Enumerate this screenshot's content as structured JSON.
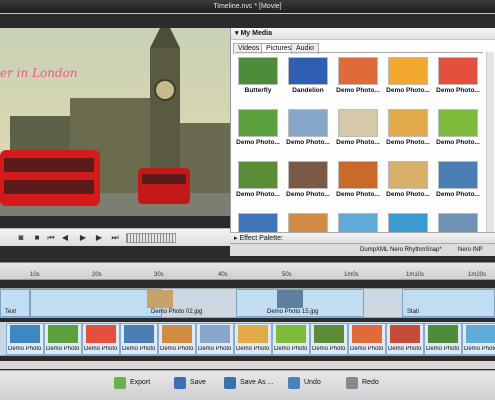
{
  "window": {
    "title": "Timeline.nvc * [Movie]"
  },
  "preview": {
    "overlay_text": "er in London"
  },
  "player": {
    "buttons": [
      "camera-icon",
      "stop-icon",
      "prev-icon",
      "rewind-icon",
      "play-icon",
      "forward-icon",
      "next-icon"
    ]
  },
  "media": {
    "header": "My Media",
    "tabs": [
      "Videos",
      "Pictures",
      "Audio"
    ],
    "active_tab": "Pictures",
    "items": [
      {
        "caption": "Butterfly",
        "color": "#4d8c3a"
      },
      {
        "caption": "Dandelion",
        "color": "#2f5fb0"
      },
      {
        "caption": "Demo Photo...",
        "color": "#e06b3a"
      },
      {
        "caption": "Demo Photo...",
        "color": "#f2a72f"
      },
      {
        "caption": "Demo Photo...",
        "color": "#e3503d"
      },
      {
        "caption": "Demo Photo...",
        "color": "#5aa13d"
      },
      {
        "caption": "Demo Photo...",
        "color": "#86a7c9"
      },
      {
        "caption": "Demo Photo...",
        "color": "#d5c9a9"
      },
      {
        "caption": "Demo Photo...",
        "color": "#e0a94a"
      },
      {
        "caption": "Demo Photo...",
        "color": "#7dbb3b"
      },
      {
        "caption": "Demo Photo...",
        "color": "#5b8d37"
      },
      {
        "caption": "Demo Photo...",
        "color": "#7a5a45"
      },
      {
        "caption": "Demo Photo...",
        "color": "#c96a2a"
      },
      {
        "caption": "Demo Photo...",
        "color": "#d8b06a"
      },
      {
        "caption": "Demo Photo...",
        "color": "#4a7fb5"
      },
      {
        "caption": "",
        "color": "#3e74b8"
      },
      {
        "caption": "",
        "color": "#d08b44"
      },
      {
        "caption": "",
        "color": "#5faad7"
      },
      {
        "caption": "",
        "color": "#3b9ad0"
      },
      {
        "caption": "",
        "color": "#6f93b6"
      }
    ]
  },
  "effects": {
    "label": "Effect Palette:"
  },
  "toolstrip": {
    "dump": "DumpXML",
    "rhythm": "Nero RhythmSnap*",
    "nero": "Nero INP"
  },
  "ruler": {
    "ticks": [
      "10s",
      "20s",
      "30s",
      "40s",
      "50s",
      "1m0s",
      "1m10s",
      "1m20s"
    ]
  },
  "track1": {
    "clips": [
      {
        "label": "Text",
        "color": "#ffffff"
      },
      {
        "label": "Demo Photo 02.jpg",
        "color": "#c7a36a"
      },
      {
        "label": "Demo Photo 15.jpg",
        "color": "#5f7f9f"
      },
      {
        "label": "Stati",
        "color": "#ffffff"
      }
    ]
  },
  "track2": {
    "clips": [
      {
        "label": "Demo Photo",
        "color": "#3f87c0"
      },
      {
        "label": "Demo Photo",
        "color": "#5aa13d"
      },
      {
        "label": "Demo Photo",
        "color": "#e3503d"
      },
      {
        "label": "Demo Photo",
        "color": "#4a7fb5"
      },
      {
        "label": "Demo Photo",
        "color": "#d08b44"
      },
      {
        "label": "Demo Photo",
        "color": "#86a7c9"
      },
      {
        "label": "Demo Photo",
        "color": "#e0a94a"
      },
      {
        "label": "Demo Photo",
        "color": "#7dbb3b"
      },
      {
        "label": "Demo Photo",
        "color": "#5b8d37"
      },
      {
        "label": "Demo Photo",
        "color": "#e06b3a"
      },
      {
        "label": "Demo Photo",
        "color": "#c44d3a"
      },
      {
        "label": "Demo Photo",
        "color": "#4d8c3a"
      },
      {
        "label": "Demo Photo",
        "color": "#5faad7"
      }
    ]
  },
  "bottom": {
    "export": "Export",
    "save": "Save",
    "save_as": "Save As ...",
    "undo": "Undo",
    "redo": "Redo"
  }
}
